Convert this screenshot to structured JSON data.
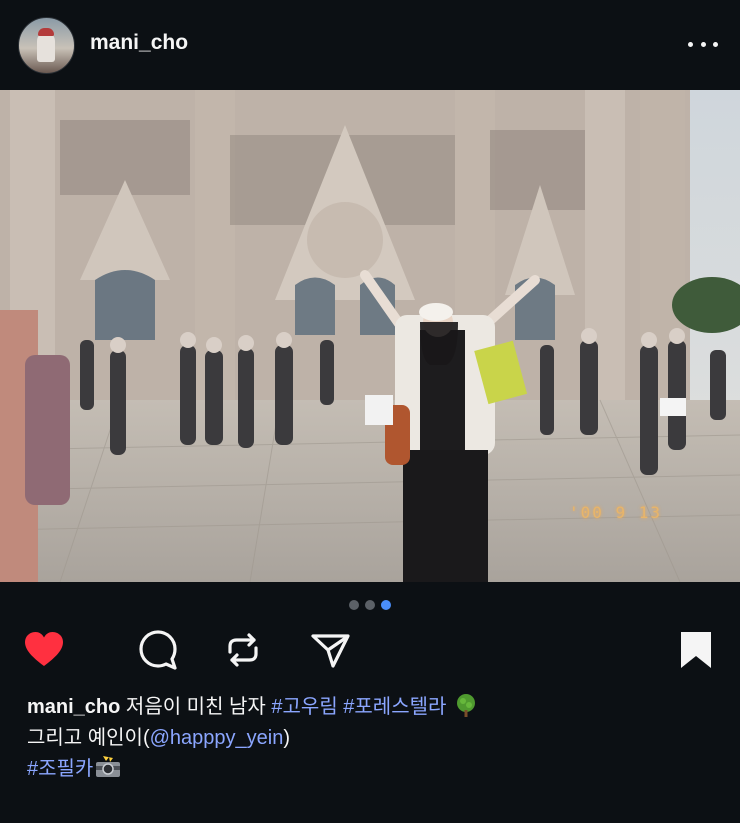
{
  "post": {
    "username": "mani_cho",
    "photo_stamp": "'00 9 13",
    "carousel": {
      "total": 3,
      "active": 3
    }
  },
  "caption": {
    "username": "mani_cho",
    "text1": " 저음이 미친 남자 ",
    "tag1": "#고우림",
    "tag2": "#포레스텔라",
    "line2_text": "그리고 예인이(",
    "mention": "@happpy_yein",
    "line2_end": ")",
    "tag3": "#조필카"
  },
  "icons": {
    "like": "heart-icon",
    "comment": "comment-icon",
    "repost": "repost-icon",
    "share": "send-icon",
    "save": "bookmark-icon",
    "more": "more-icon"
  },
  "colors": {
    "background": "#0c1014",
    "like": "#ff3040",
    "link": "#8ba6ff",
    "carousel_active": "#4a8df8"
  }
}
